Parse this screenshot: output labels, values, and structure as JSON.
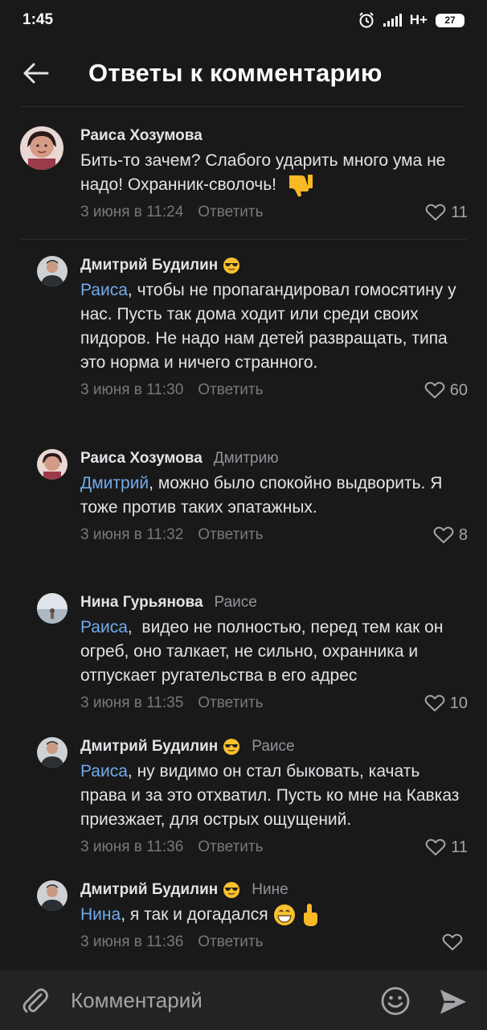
{
  "status": {
    "time": "1:45",
    "network": "H+",
    "battery": "27"
  },
  "header": {
    "title": "Ответы к комментарию"
  },
  "comments": [
    {
      "author": "Раиса Хозумова",
      "reply_to": "",
      "mention": "",
      "text": "Бить-то зачем? Слабого ударить много ума не надо! Охранник-сволочь!",
      "date": "3 июня в 11:24",
      "reply": "Ответить",
      "likes": "11"
    },
    {
      "author": "Дмитрий Будилин",
      "reply_to": "",
      "mention": "Раиса",
      "text": ", чтобы не пропагандировал гомосятину у нас. Пусть так дома ходит или среди своих пидоров. Не надо нам детей развращать, типа это норма и ничего странного.",
      "date": "3 июня в 11:30",
      "reply": "Ответить",
      "likes": "60"
    },
    {
      "author": "Раиса Хозумова",
      "reply_to": "Дмитрию",
      "mention": "Дмитрий",
      "text": ", можно было спокойно выдворить. Я тоже против таких эпатажных.",
      "date": "3 июня в 11:32",
      "reply": "Ответить",
      "likes": "8"
    },
    {
      "author": "Нина Гурьянова",
      "reply_to": "Раисе",
      "mention": "Раиса",
      "text": ",  видео не полностью, перед тем как он огреб, оно талкает, не сильно, охранника и отпускает ругательства в его адрес",
      "date": "3 июня в 11:35",
      "reply": "Ответить",
      "likes": "10"
    },
    {
      "author": "Дмитрий Будилин",
      "reply_to": "Раисе",
      "mention": "Раиса",
      "text": ", ну видимо он стал быковать, качать права и за это отхватил. Пусть ко мне на Кавказ приезжает, для острых ощущений.",
      "date": "3 июня в 11:36",
      "reply": "Ответить",
      "likes": "11"
    },
    {
      "author": "Дмитрий Будилин",
      "reply_to": "Нине",
      "mention": "Нина",
      "text": ", я так и догадался",
      "date": "3 июня в 11:36",
      "reply": "Ответить",
      "likes": ""
    }
  ],
  "composer": {
    "placeholder": "Комментарий"
  },
  "colors": {
    "background": "#19191a",
    "accent": "#71aaeb",
    "composer": "#232324"
  }
}
